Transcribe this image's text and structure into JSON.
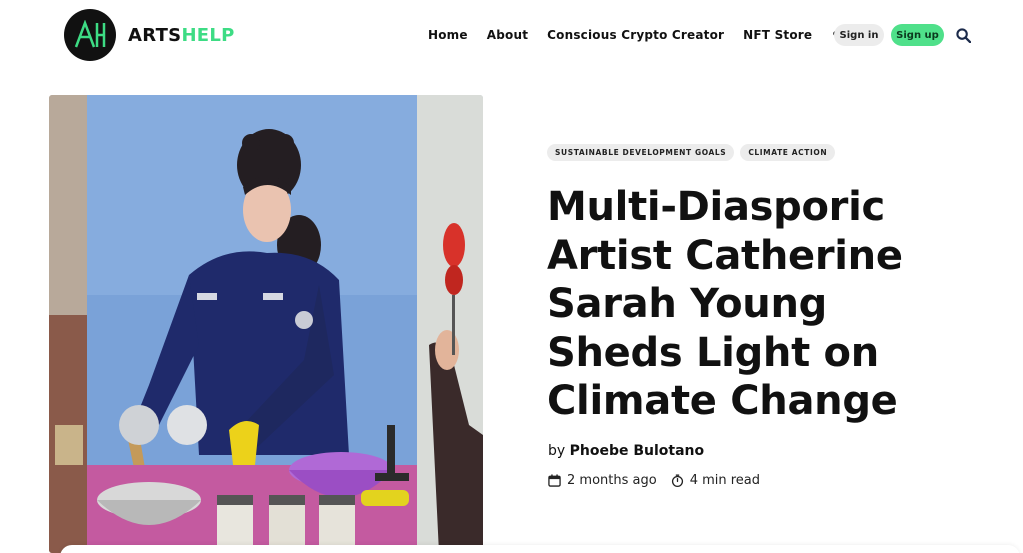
{
  "brand": {
    "name_part1": "ARTS",
    "name_part2": "HELP",
    "accent": "#3ddc84"
  },
  "nav": {
    "items": [
      "Home",
      "About",
      "Conscious Crypto Creator",
      "NFT Store"
    ],
    "more_glyph": "•••",
    "signin_label": "Sign in",
    "signup_label": "Sign up",
    "search_icon": "search-icon"
  },
  "article": {
    "tags": [
      "SUSTAINABLE DEVELOPMENT GOALS",
      "CLIMATE ACTION"
    ],
    "title": "Multi-Diasporic Artist Catherine Sarah Young Sheds Light on Climate Change",
    "by_label": "by",
    "author": "Phoebe Bulotano",
    "posted": "2 months ago",
    "read_time": "4 min read"
  },
  "colors": {
    "signup_bg": "#4fe08a",
    "hero_backdrop": "#7aa2d8",
    "jumpsuit": "#1f2a6b"
  }
}
